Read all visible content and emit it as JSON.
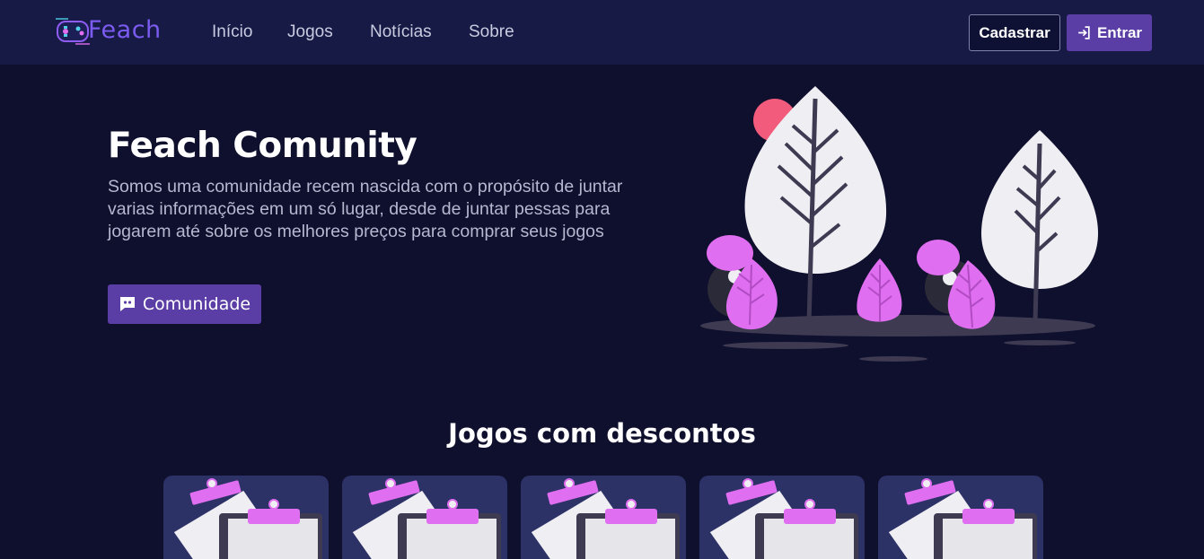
{
  "brand": {
    "name": "Feach"
  },
  "nav": {
    "links": [
      "Início",
      "Jogos",
      "Notícias",
      "Sobre"
    ],
    "signup_label": "Cadastrar",
    "login_label": "Entrar"
  },
  "hero": {
    "title": "Feach Comunity",
    "description": "Somos uma comunidade recem nascida com o propósito de juntar varias informações em um só lugar, desde de juntar pessas para jogarem até sobre os melhores preços para comprar seus jogos",
    "cta_label": "Comunidade"
  },
  "deals": {
    "title": "Jogos com descontos",
    "cards": [
      {},
      {},
      {},
      {},
      {}
    ]
  },
  "colors": {
    "background": "#0f0f2e",
    "navbar": "#161a45",
    "accent": "#5b3da6",
    "pink": "#e06ef0",
    "card": "#2c3166"
  },
  "icons": {
    "login": "sign-in-icon",
    "community": "discord-icon"
  }
}
